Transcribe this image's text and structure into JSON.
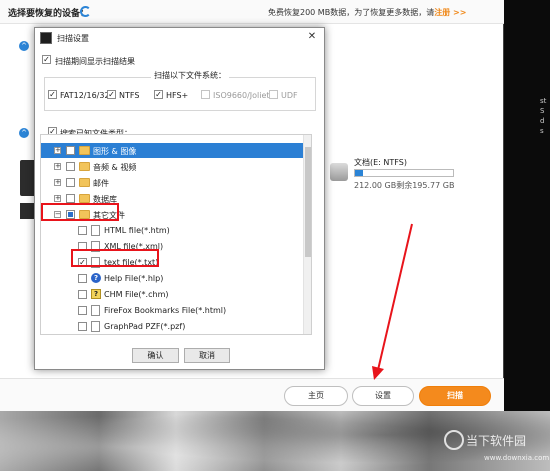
{
  "app": {
    "header_title": "选择要恢复的设备：",
    "free_text": "免费恢复200 MB数据，为了恢复更多数据，请",
    "register_link": "注册 >>",
    "drive": {
      "name": "文档(E: NTFS)",
      "stats": "212.00 GB剩余195.77 GB",
      "free_fraction": 0.08
    },
    "footer": {
      "home_label": "主页",
      "settings_label": "设置",
      "scan_label": "扫描"
    }
  },
  "dialog": {
    "title": "扫描设置",
    "close_glyph": "✕",
    "show_results_label": "扫描期间显示扫描结果",
    "fs_group_title": "扫描以下文件系统：",
    "filesystems": [
      {
        "label": "FAT12/16/32",
        "checked": true,
        "enabled": true
      },
      {
        "label": "NTFS",
        "checked": true,
        "enabled": true
      },
      {
        "label": "HFS+",
        "checked": true,
        "enabled": true
      },
      {
        "label": "ISO9660/Joliet",
        "checked": false,
        "enabled": false
      },
      {
        "label": "UDF",
        "checked": false,
        "enabled": false
      }
    ],
    "search_types_label": "搜索已知文件类型：",
    "tree": {
      "expand_glyph": "+",
      "collapse_glyph": "−",
      "help_glyph": "?",
      "chm_glyph": "?",
      "categories": [
        {
          "label": "图形 & 图像"
        },
        {
          "label": "音频 & 视频"
        },
        {
          "label": "邮件"
        },
        {
          "label": "数据库"
        },
        {
          "label": "其它文件"
        }
      ],
      "files": [
        {
          "label": "HTML file(*.htm)",
          "checked": false
        },
        {
          "label": "XML file(*.xml)",
          "checked": false
        },
        {
          "label": "text file(*.txt)",
          "checked": true
        },
        {
          "label": "Help File(*.hlp)",
          "checked": false
        },
        {
          "label": "CHM File(*.chm)",
          "checked": false
        },
        {
          "label": "FireFox Bookmarks File(*.html)",
          "checked": false
        },
        {
          "label": "GraphPad PZF(*.pzf)",
          "checked": false
        }
      ]
    },
    "ok_label": "确认",
    "cancel_label": "取消"
  },
  "watermark": {
    "name": "当下软件园",
    "url": "www.downxia.com"
  },
  "side_hint": "st\nS\nd\ns",
  "colors": {
    "accent_blue": "#2b7fd4",
    "scan_orange": "#f48a1d",
    "annotation_red": "#e8141b"
  }
}
